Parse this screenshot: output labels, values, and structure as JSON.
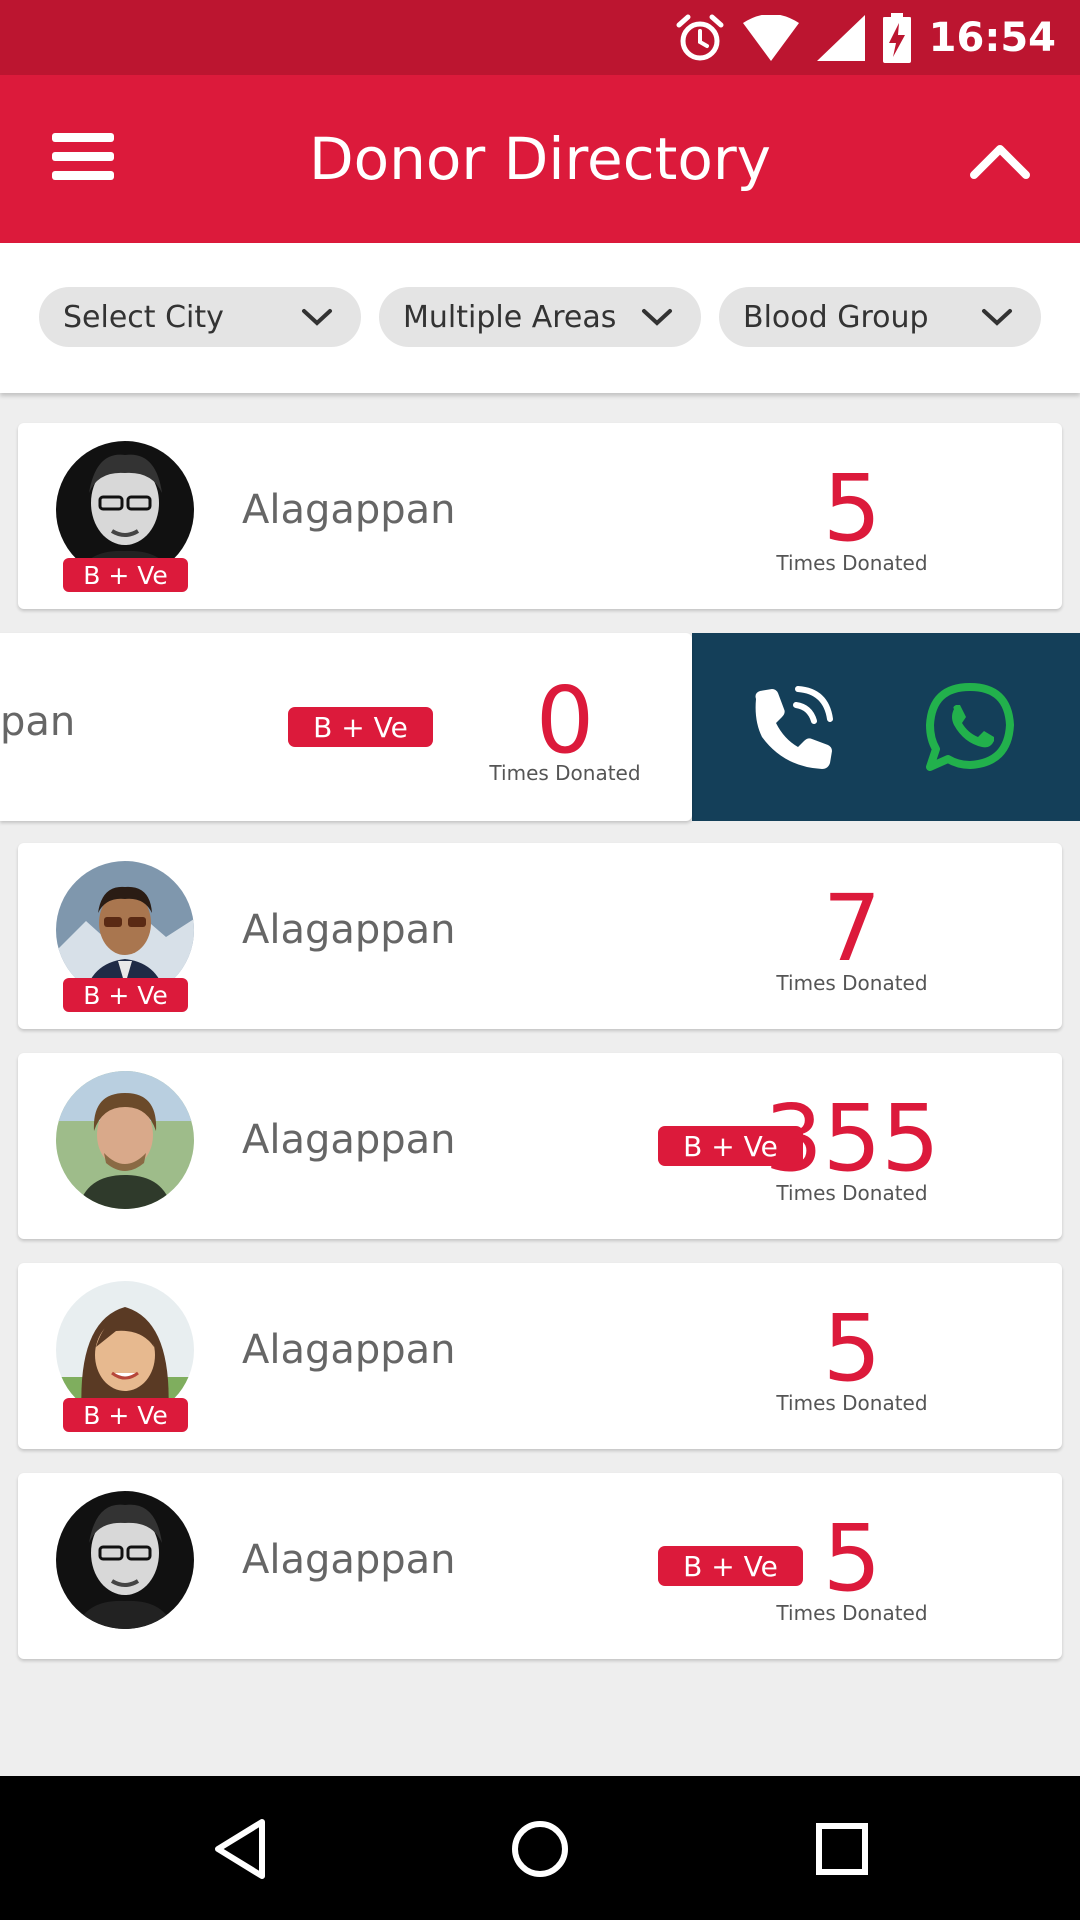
{
  "status_bar": {
    "time": "16:54",
    "icons": [
      "alarm-icon",
      "wifi-icon",
      "signal-icon",
      "battery-charging-icon"
    ]
  },
  "app_bar": {
    "title": "Donor Directory",
    "menu_icon": "hamburger-menu-icon",
    "collapse_icon": "chevron-up-icon"
  },
  "filters": [
    {
      "label": "Select City"
    },
    {
      "label": "Multiple Areas"
    },
    {
      "label": "Blood Group"
    }
  ],
  "donors": [
    {
      "name": "Alagappan",
      "blood_group": "B + Ve",
      "count": "5",
      "count_label": "Times Donated"
    },
    {
      "name": "Alagappan",
      "blood_group": "B + Ve",
      "count": "0",
      "count_label": "Times Donated",
      "visible_name_fragment": "pan"
    },
    {
      "name": "Alagappan",
      "blood_group": "B + Ve",
      "count": "7",
      "count_label": "Times Donated"
    },
    {
      "name": "Alagappan",
      "blood_group": "B + Ve",
      "count": "355",
      "count_label": "Times Donated"
    },
    {
      "name": "Alagappan",
      "blood_group": "B + Ve",
      "count": "5",
      "count_label": "Times Donated"
    },
    {
      "name": "Alagappan",
      "blood_group": "B + Ve",
      "count": "5",
      "count_label": "Times Donated"
    }
  ],
  "swipe_actions": {
    "call_icon": "phone-call-icon",
    "whatsapp_icon": "whatsapp-icon"
  },
  "nav_bar": {
    "icons": [
      "back-icon",
      "home-icon",
      "recents-icon"
    ]
  },
  "colors": {
    "status_bar": "#bc1530",
    "primary": "#dc1a3b",
    "action_panel": "#143f59",
    "whatsapp_green": "#22b14c"
  }
}
